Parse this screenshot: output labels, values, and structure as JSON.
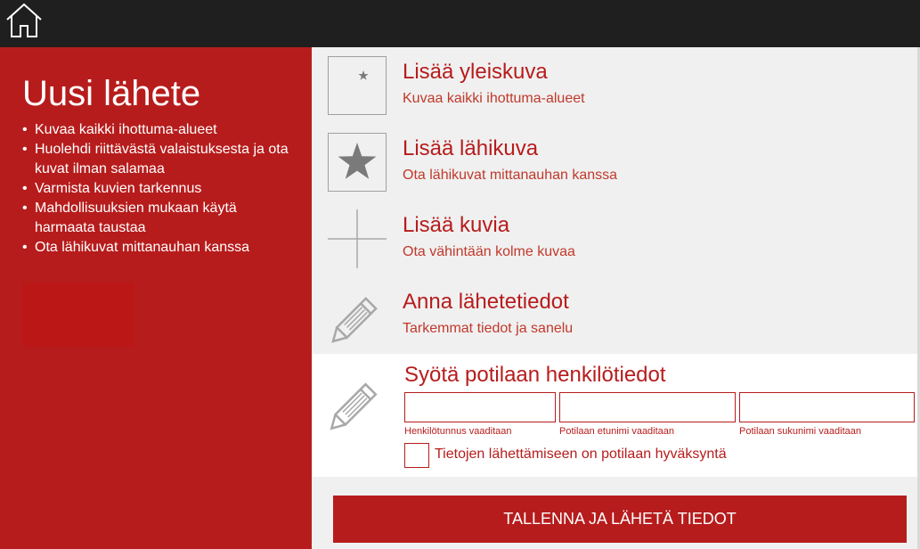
{
  "header": {
    "home_icon": "home-icon"
  },
  "sidebar": {
    "title": "Uusi lähete",
    "tips": [
      "Kuvaa kaikki ihottuma-alueet",
      "Huolehdi riittävästä valaistuksesta ja ota kuvat ilman salamaa",
      "Varmista kuvien tarkennus",
      "Mahdollisuuksien mukaan käytä harmaata taustaa",
      "Ota lähikuvat mittanauhan kanssa"
    ]
  },
  "actions": [
    {
      "title": "Lisää yleiskuva",
      "subtitle": "Kuvaa kaikki ihottuma-alueet",
      "icon": "small-star-icon"
    },
    {
      "title": "Lisää lähikuva",
      "subtitle": "Ota lähikuvat mittanauhan kanssa",
      "icon": "large-star-icon"
    },
    {
      "title": "Lisää kuvia",
      "subtitle": "Ota vähintään kolme kuvaa",
      "icon": "plus-icon"
    },
    {
      "title": "Anna lähetetiedot",
      "subtitle": "Tarkemmat tiedot ja sanelu",
      "icon": "pencil-icon"
    }
  ],
  "patient": {
    "title": "Syötä potilaan henkilötiedot",
    "icon": "pencil-icon",
    "fields": [
      {
        "value": "",
        "label": "Henkilötunnus vaaditaan"
      },
      {
        "value": "",
        "label": "Potilaan etunimi vaaditaan"
      },
      {
        "value": "",
        "label": "Potilaan sukunimi vaaditaan"
      }
    ],
    "consent_label": "Tietojen lähettämiseen on potilaan hyväksyntä",
    "consent_checked": false
  },
  "save_label": "TALLENNA JA LÄHETÄ TIEDOT",
  "colors": {
    "accent": "#b71c1c",
    "topbar": "#1f1f1f",
    "panel": "#f0f0f0"
  }
}
